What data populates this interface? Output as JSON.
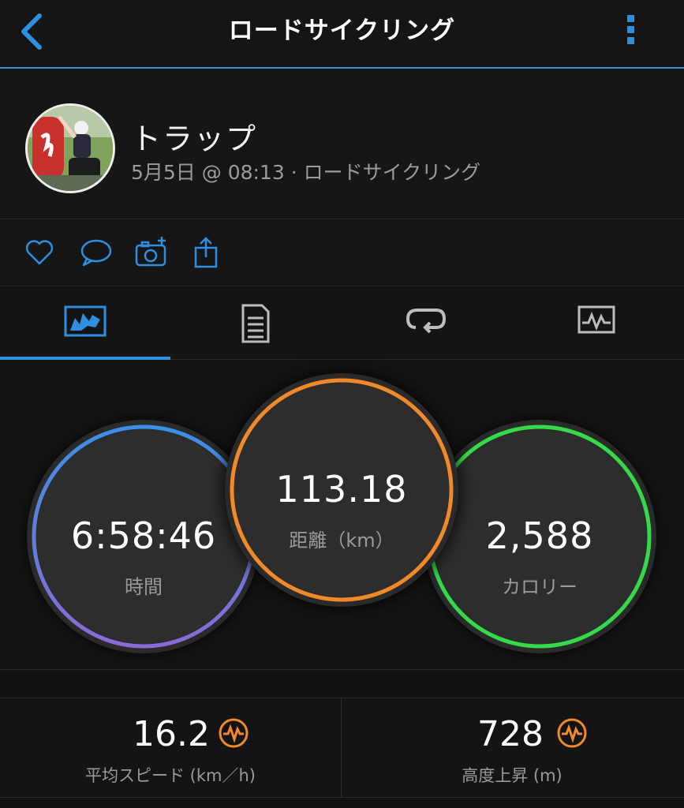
{
  "header": {
    "title": "ロードサイクリング",
    "accent": "#2e8fe0"
  },
  "profile": {
    "name": "トラップ",
    "meta": "5月5日 @ 08:13 · ロードサイクリング"
  },
  "actions": [
    {
      "icon": "heart-icon"
    },
    {
      "icon": "comment-icon"
    },
    {
      "icon": "add-photo-icon"
    },
    {
      "icon": "share-icon"
    }
  ],
  "tabs": [
    {
      "icon": "overview-map-icon",
      "active": true
    },
    {
      "icon": "details-list-icon",
      "active": false
    },
    {
      "icon": "laps-icon",
      "active": false
    },
    {
      "icon": "graph-icon",
      "active": false
    }
  ],
  "stats": {
    "time": {
      "value": "6:58:46",
      "label": "時間",
      "color": "#4a90e2"
    },
    "distance": {
      "value": "113.18",
      "label": "距離（km）",
      "color": "#f0892a"
    },
    "calories": {
      "value": "2,588",
      "label": "カロリー",
      "color": "#35d94a"
    }
  },
  "summary": {
    "avg_speed": {
      "value": "16.2",
      "label": "平均スピード (km／h)",
      "badge_color": "#f0892a"
    },
    "elevation_gain": {
      "value": "728",
      "label": "高度上昇 (m)",
      "badge_color": "#f0892a"
    }
  }
}
